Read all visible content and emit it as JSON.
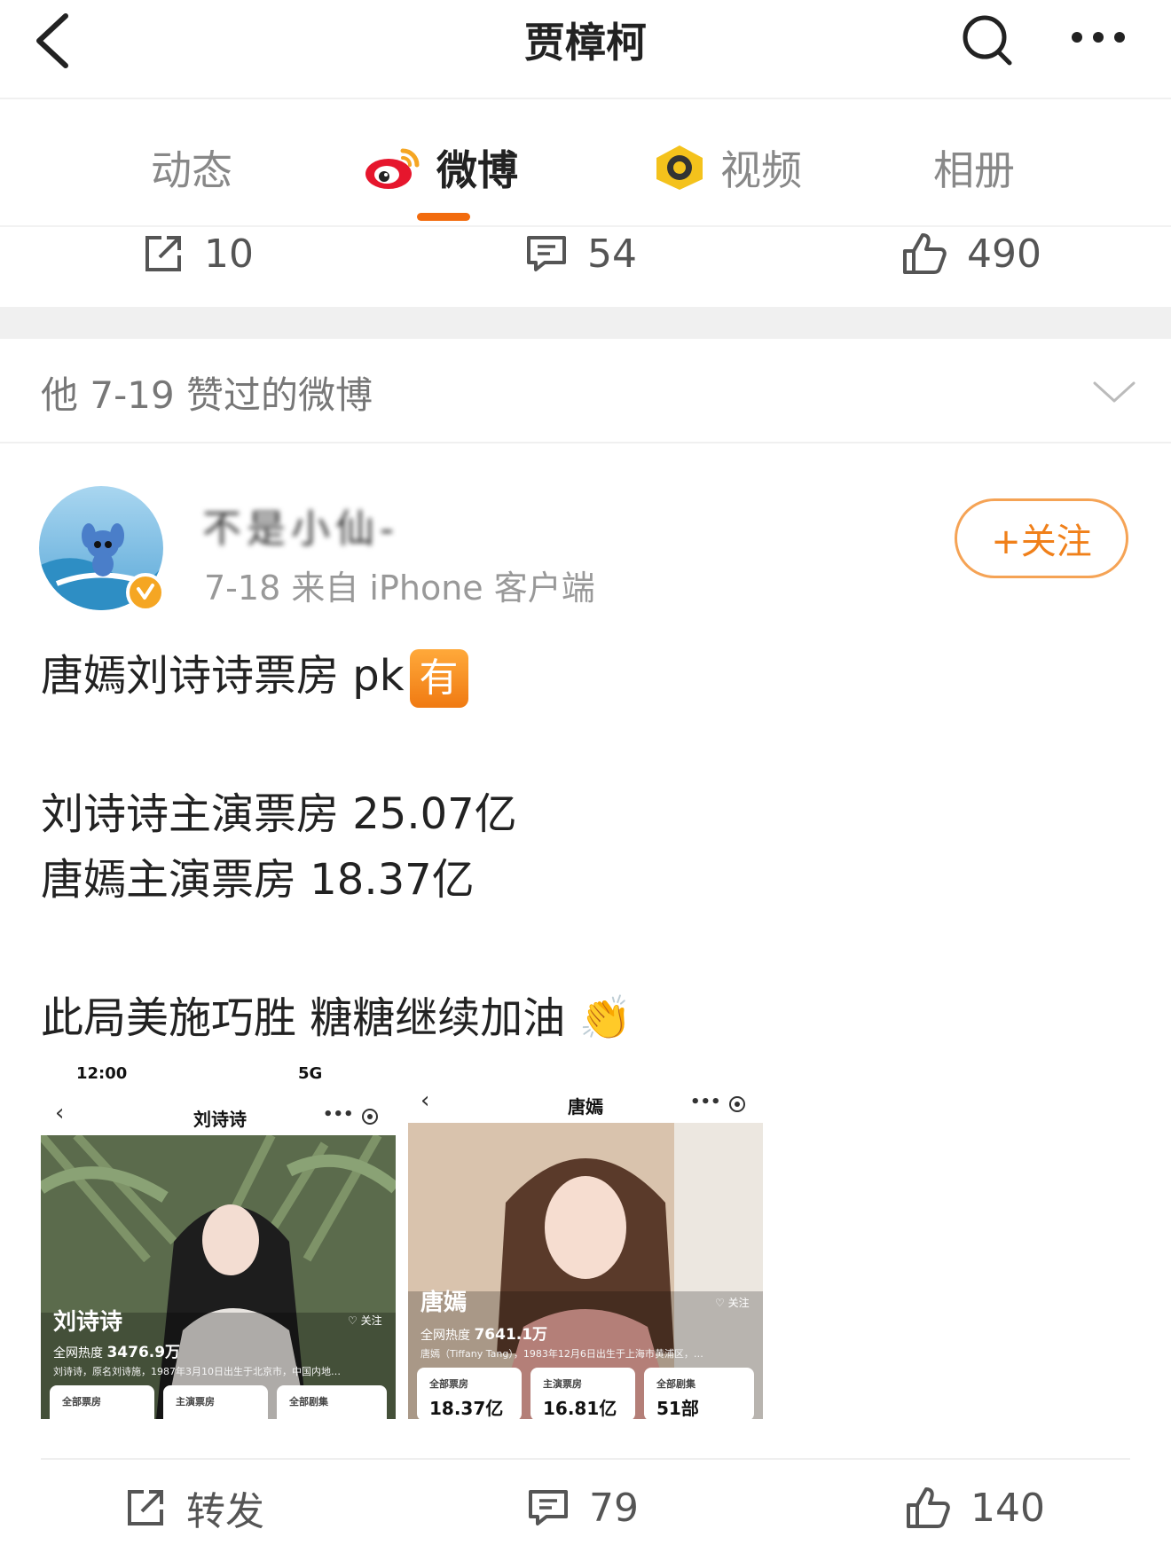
{
  "header": {
    "title": "贾樟柯"
  },
  "tabs": [
    {
      "label": "动态",
      "icon": ""
    },
    {
      "label": "微博",
      "icon": "weibo-logo-icon"
    },
    {
      "label": "视频",
      "icon": "video-badge-icon"
    },
    {
      "label": "相册",
      "icon": ""
    }
  ],
  "active_tab": "微博",
  "previous_post_actions": {
    "repost": "10",
    "comment": "54",
    "like": "490"
  },
  "liked_section": {
    "text": "他 7-19 赞过的微博"
  },
  "post": {
    "author": "不是小仙-",
    "meta": "7-18  来自 iPhone 客户端",
    "follow_label": "+关注",
    "line1": "唐嫣刘诗诗票房 pk",
    "badge": "有",
    "line2": "刘诗诗主演票房 25.07亿",
    "line3": "唐嫣主演票房 18.37亿",
    "line4": "此局美施巧胜 糖糖继续加油",
    "line4_emoji": "👏",
    "images": [
      {
        "status_time": "12:00",
        "status_right": "5G",
        "title": "刘诗诗",
        "name": "刘诗诗",
        "heat_label": "全网热度",
        "heat_value": "3476.9万",
        "bio": "刘诗诗，原名刘诗施，1987年3月10日出生于北京市，中国内地…",
        "fav": "关注",
        "stats": [
          "全部票房",
          "主演票房",
          "全部剧集"
        ]
      },
      {
        "title": "唐嫣",
        "name": "唐嫣",
        "heat_label": "全网热度",
        "heat_value": "7641.1万",
        "bio": "唐嫣（Tiffany Tang），1983年12月6日出生于上海市黄浦区，…",
        "fav": "关注",
        "stats": [
          {
            "label": "全部票房",
            "value": "18.37亿"
          },
          {
            "label": "主演票房",
            "value": "16.81亿"
          },
          {
            "label": "全部剧集",
            "value": "51部"
          }
        ]
      }
    ]
  },
  "post_actions": {
    "repost": "转发",
    "comment": "79",
    "like": "140"
  },
  "colors": {
    "accent": "#f26b0d",
    "follow": "#f0801a",
    "badge": "#f5a623"
  }
}
